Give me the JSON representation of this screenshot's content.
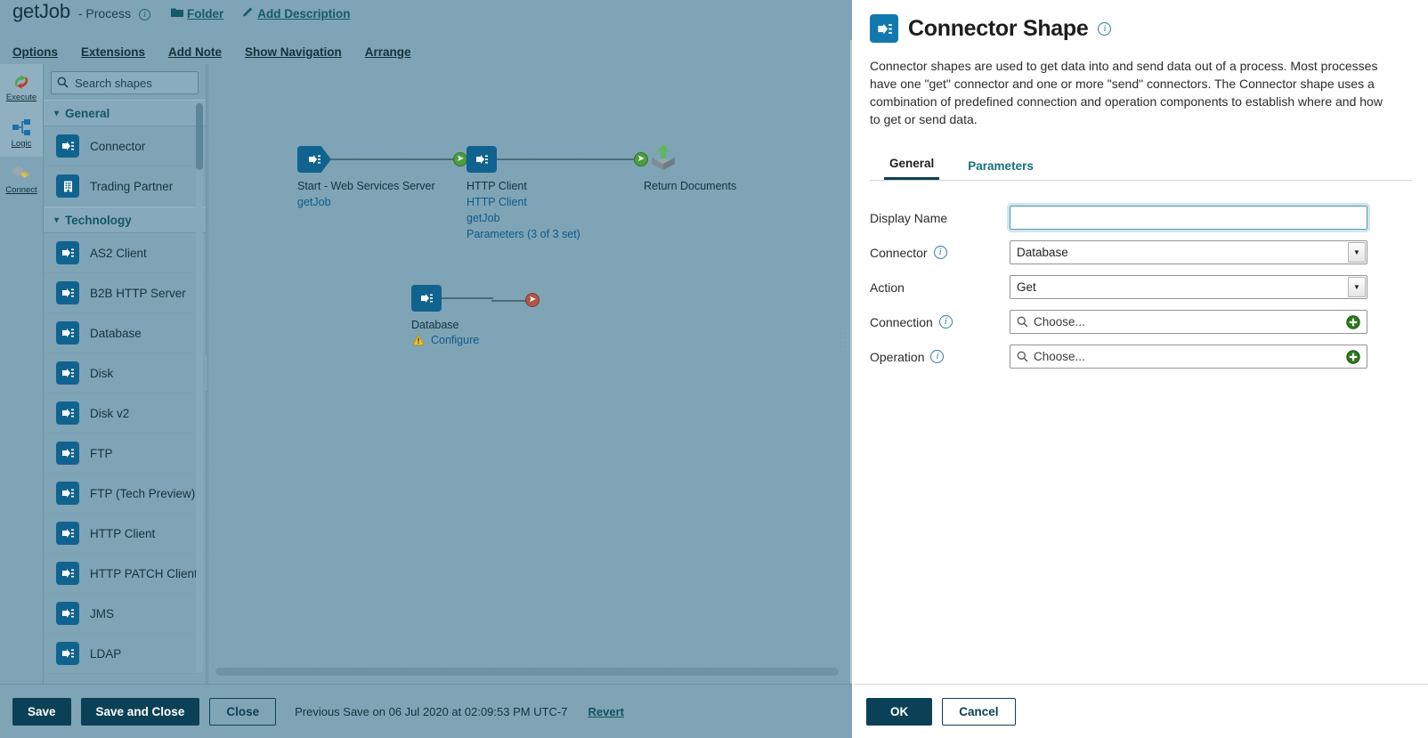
{
  "process": {
    "name": "getJob",
    "type_label": "- Process",
    "info_icon": "info-icon",
    "folder_label": "Folder",
    "folder_icon": "folder-icon",
    "add_description_label": "Add Description",
    "pencil_icon": "pencil-icon",
    "menu": [
      {
        "label": "Options",
        "name": "menu-options"
      },
      {
        "label": "Extensions",
        "name": "menu-extensions"
      },
      {
        "label": "Add Note",
        "name": "menu-add-note"
      },
      {
        "label": "Show Navigation",
        "name": "menu-show-navigation"
      },
      {
        "label": "Arrange",
        "name": "menu-arrange"
      }
    ]
  },
  "rail": {
    "items": [
      {
        "label": "Execute",
        "icon": "execute-icon",
        "active": true
      },
      {
        "label": "Logic",
        "icon": "logic-icon",
        "active": true
      },
      {
        "label": "Connect",
        "icon": "connect-icon",
        "active": false
      }
    ]
  },
  "search": {
    "placeholder": "Search shapes",
    "value": "",
    "icon": "search-icon"
  },
  "shape_palette": {
    "groups": [
      {
        "label": "General",
        "expanded": true,
        "chevron": "chevron-down-icon",
        "shapes": [
          {
            "label": "Connector",
            "icon": "connector-shape-icon"
          },
          {
            "label": "Trading Partner",
            "icon": "trading-partner-icon"
          }
        ]
      },
      {
        "label": "Technology",
        "expanded": true,
        "chevron": "chevron-down-icon",
        "shapes": [
          {
            "label": "AS2 Client",
            "icon": "connector-shape-icon"
          },
          {
            "label": "B2B HTTP Server",
            "icon": "connector-shape-icon"
          },
          {
            "label": "Database",
            "icon": "connector-shape-icon"
          },
          {
            "label": "Disk",
            "icon": "connector-shape-icon"
          },
          {
            "label": "Disk v2",
            "icon": "connector-shape-icon"
          },
          {
            "label": "FTP",
            "icon": "connector-shape-icon"
          },
          {
            "label": "FTP (Tech Preview)",
            "icon": "connector-shape-icon"
          },
          {
            "label": "HTTP Client",
            "icon": "connector-shape-icon"
          },
          {
            "label": "HTTP PATCH Client",
            "icon": "connector-shape-icon"
          },
          {
            "label": "JMS",
            "icon": "connector-shape-icon"
          },
          {
            "label": "LDAP",
            "icon": "connector-shape-icon"
          }
        ]
      }
    ]
  },
  "canvas": {
    "collapse_icon": "chevron-left-icon",
    "nodes": [
      {
        "id": "start",
        "caption": "Start - Web Services Server",
        "link": "getJob",
        "shape": "connector-start-shape",
        "extra_links": []
      },
      {
        "id": "http-client",
        "caption": "HTTP Client",
        "link": "HTTP Client",
        "shape": "connector-shape",
        "extra_links": [
          "getJob",
          "Parameters (3 of 3 set)"
        ]
      },
      {
        "id": "return-documents",
        "caption": "Return Documents",
        "link": "",
        "shape": "return-documents-shape",
        "extra_links": []
      },
      {
        "id": "database",
        "caption": "Database",
        "link": "Configure",
        "shape": "connector-shape",
        "warning_icon": "warning-icon",
        "extra_links": []
      }
    ]
  },
  "bottom_bar": {
    "save_label": "Save",
    "save_and_close_label": "Save and Close",
    "close_label": "Close",
    "previous_save_text": "Previous Save on 06 Jul 2020 at 02:09:53 PM UTC-7",
    "revert_label": "Revert"
  },
  "dialog": {
    "title": "Connector Shape",
    "title_icon": "connector-shape-icon",
    "info_icon": "info-icon",
    "description": "Connector shapes are used to get data into and send data out of a process. Most processes have one \"get\" connector and one or more \"send\" connectors. The Connector shape uses a combination of predefined connection and operation components to establish where and how to get or send data.",
    "tabs": [
      {
        "label": "General",
        "active": true
      },
      {
        "label": "Parameters",
        "active": false
      }
    ],
    "fields": [
      {
        "label": "Display Name",
        "kind": "text",
        "value": "",
        "placeholder": "",
        "has_info": false,
        "focused": true
      },
      {
        "label": "Connector",
        "kind": "select",
        "value": "Database",
        "has_info": true,
        "info_icon": "info-icon",
        "caret_icon": "caret-down-icon"
      },
      {
        "label": "Action",
        "kind": "select",
        "value": "Get",
        "has_info": false,
        "caret_icon": "caret-down-icon"
      },
      {
        "label": "Connection",
        "kind": "chooser",
        "value": "Choose...",
        "has_info": true,
        "info_icon": "info-icon",
        "search_icon": "search-icon",
        "add_icon": "add-circle-icon"
      },
      {
        "label": "Operation",
        "kind": "chooser",
        "value": "Choose...",
        "has_info": true,
        "info_icon": "info-icon",
        "search_icon": "search-icon",
        "add_icon": "add-circle-icon"
      }
    ],
    "footer": {
      "ok_label": "OK",
      "cancel_label": "Cancel"
    }
  },
  "colors": {
    "canvas_bg": "#7fa4b6",
    "connector_tile": "#10638f",
    "dialog_tile": "#1179ae",
    "primary_button": "#0b4157",
    "link": "#0d5a8a",
    "teal_link": "#135a6b",
    "arrow_green": "#4a9e3f",
    "arrow_red": "#b0564a",
    "tab_active_underline": "#0b4157",
    "focus_ring": "#cfe6ee"
  }
}
